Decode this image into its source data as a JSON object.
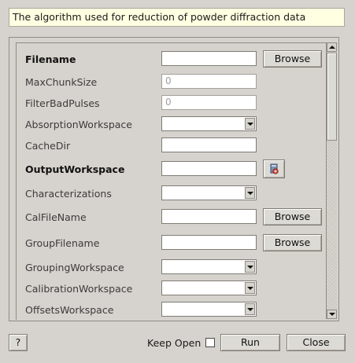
{
  "description": "The algorithm used for reduction of powder diffraction data",
  "properties": [
    {
      "label": "Filename",
      "bold": true,
      "widget": "text",
      "value": "",
      "button": "Browse"
    },
    {
      "label": "MaxChunkSize",
      "bold": false,
      "widget": "text",
      "value": "0",
      "disabled": true
    },
    {
      "label": "FilterBadPulses",
      "bold": false,
      "widget": "text",
      "value": "0",
      "disabled": true
    },
    {
      "label": "AbsorptionWorkspace",
      "bold": false,
      "widget": "combo",
      "value": ""
    },
    {
      "label": "CacheDir",
      "bold": false,
      "widget": "text",
      "value": ""
    },
    {
      "label": "OutputWorkspace",
      "bold": true,
      "widget": "text",
      "value": "",
      "icon": "workspace-picker-icon"
    },
    {
      "label": "Characterizations",
      "bold": false,
      "widget": "combo",
      "value": ""
    },
    {
      "label": "CalFileName",
      "bold": false,
      "widget": "text",
      "value": "",
      "button": "Browse"
    },
    {
      "label": "GroupFilename",
      "bold": false,
      "widget": "text",
      "value": "",
      "button": "Browse"
    },
    {
      "label": "GroupingWorkspace",
      "bold": false,
      "widget": "combo",
      "value": ""
    },
    {
      "label": "CalibrationWorkspace",
      "bold": false,
      "widget": "combo",
      "value": ""
    },
    {
      "label": "OffsetsWorkspace",
      "bold": false,
      "widget": "combo",
      "value": ""
    }
  ],
  "footer": {
    "help_label": "?",
    "keep_open_label": "Keep Open",
    "keep_open_checked": false,
    "run_label": "Run",
    "close_label": "Close"
  }
}
